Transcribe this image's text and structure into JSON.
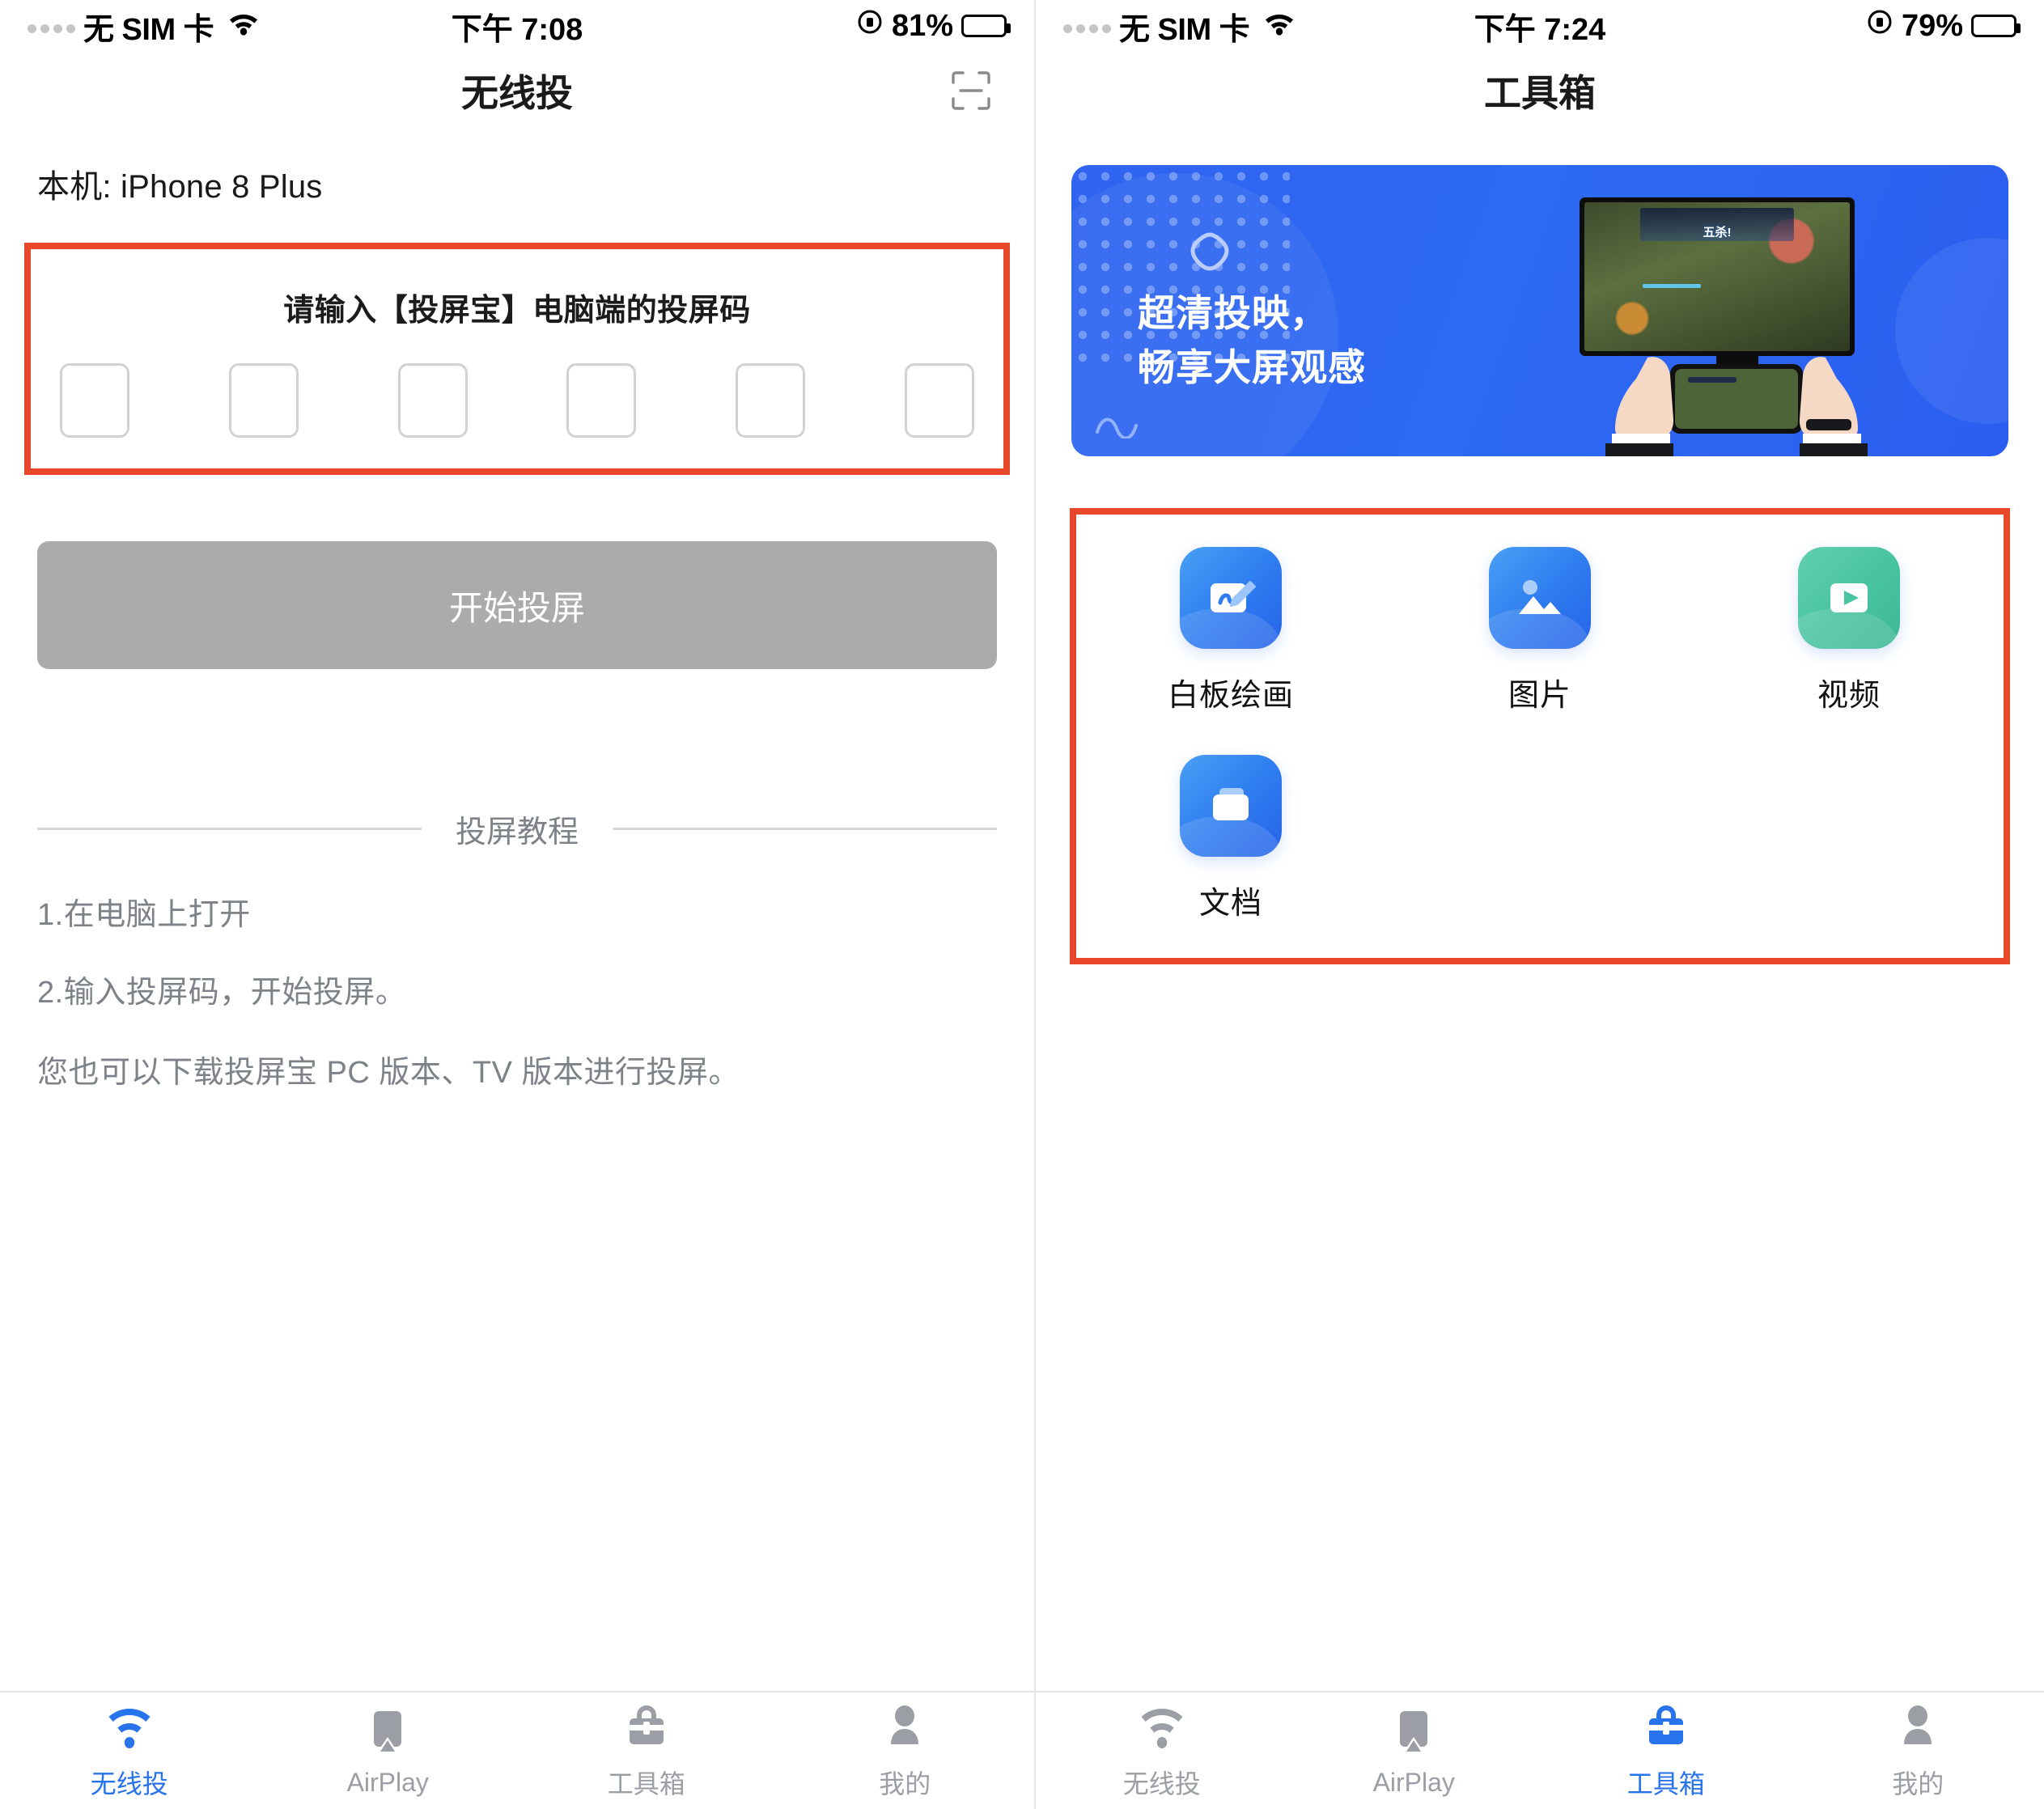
{
  "screens": [
    {
      "status_bar": {
        "carrier": "无 SIM 卡",
        "wifi_icon": "wifi-icon",
        "time": "下午 7:08",
        "rotation_lock_icon": "rotation-lock-icon",
        "battery_percent": "81%",
        "battery_icon": "battery-icon"
      },
      "nav": {
        "title": "无线投",
        "scan_icon": "scan-qr-icon"
      },
      "device": {
        "label": "本机: iPhone 8 Plus"
      },
      "code_panel": {
        "prompt": "请输入【投屏宝】电脑端的投屏码",
        "boxes": [
          "",
          "",
          "",
          "",
          "",
          ""
        ],
        "highlight_color": "#e8472a"
      },
      "start_button": {
        "label": "开始投屏",
        "color": "#ababab",
        "text_color": "#ffffff"
      },
      "tutorial": {
        "divider_label": "投屏教程",
        "steps": [
          "1.在电脑上打开",
          "2.输入投屏码，开始投屏。"
        ],
        "note": "您也可以下载投屏宝 PC 版本、TV 版本进行投屏。"
      },
      "tabbar": {
        "active_color": "#2673eb",
        "inactive_color": "#9c9ea6",
        "items": [
          {
            "label": "无线投",
            "icon": "wifi-cast-icon",
            "active": true
          },
          {
            "label": "AirPlay",
            "icon": "airplay-icon",
            "active": false
          },
          {
            "label": "工具箱",
            "icon": "toolbox-icon",
            "active": false
          },
          {
            "label": "我的",
            "icon": "person-icon",
            "active": false
          }
        ]
      }
    },
    {
      "status_bar": {
        "carrier": "无 SIM 卡",
        "wifi_icon": "wifi-icon",
        "time": "下午 7:24",
        "rotation_lock_icon": "rotation-lock-icon",
        "battery_percent": "79%",
        "battery_icon": "battery-icon"
      },
      "nav": {
        "title": "工具箱"
      },
      "banner": {
        "headline_line1": "超清投映，",
        "headline_line2": "畅享大屏观感",
        "background_color": "#2f63f0",
        "logo_icon": "triangle-rounded-logo-icon",
        "tv_icon": "tv-screen-icon",
        "tv_overlay_text": "五杀!",
        "phone_in_hands_icon": "hands-holding-phone-icon"
      },
      "tools": {
        "highlight_color": "#e8472a",
        "items": [
          {
            "label": "白板绘画",
            "icon": "whiteboard-pen-icon",
            "color": "blue"
          },
          {
            "label": "图片",
            "icon": "image-icon",
            "color": "blue"
          },
          {
            "label": "视频",
            "icon": "video-play-icon",
            "color": "green"
          },
          {
            "label": "文档",
            "icon": "document-folder-icon",
            "color": "blue"
          }
        ]
      },
      "tabbar": {
        "active_color": "#2673eb",
        "inactive_color": "#9c9ea6",
        "items": [
          {
            "label": "无线投",
            "icon": "wifi-cast-icon",
            "active": false
          },
          {
            "label": "AirPlay",
            "icon": "airplay-icon",
            "active": false
          },
          {
            "label": "工具箱",
            "icon": "toolbox-icon",
            "active": true
          },
          {
            "label": "我的",
            "icon": "person-icon",
            "active": false
          }
        ]
      }
    }
  ]
}
